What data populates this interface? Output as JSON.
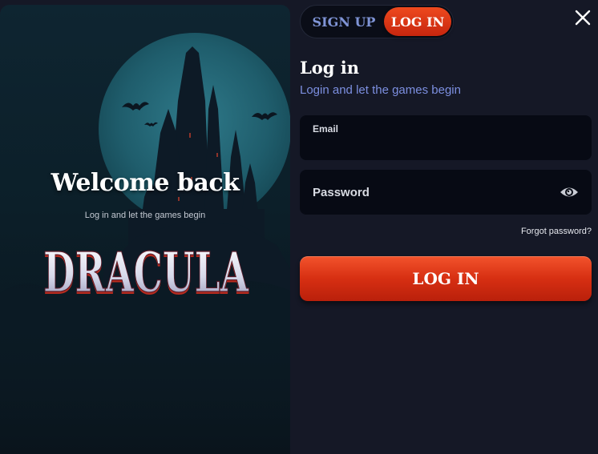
{
  "promo": {
    "welcome_title": "Welcome back",
    "welcome_subtitle": "Log in and let the games begin",
    "logo_text": "DRACULA"
  },
  "tabs": {
    "signup_label": "SIGN UP",
    "login_label": "LOG IN",
    "active": "login"
  },
  "form": {
    "title": "Log in",
    "subtitle": "Login and let the games begin",
    "email": {
      "label": "Email",
      "value": ""
    },
    "password": {
      "placeholder": "Password",
      "value": ""
    },
    "forgot_password": "Forgot password?",
    "submit_label": "LOG IN"
  },
  "icons": {
    "close": "close-icon",
    "eye": "eye-icon"
  },
  "colors": {
    "background": "#151826",
    "accent": "#e03a16",
    "subtitle_blue": "#7c8fe0",
    "field_bg": "#070a14"
  }
}
